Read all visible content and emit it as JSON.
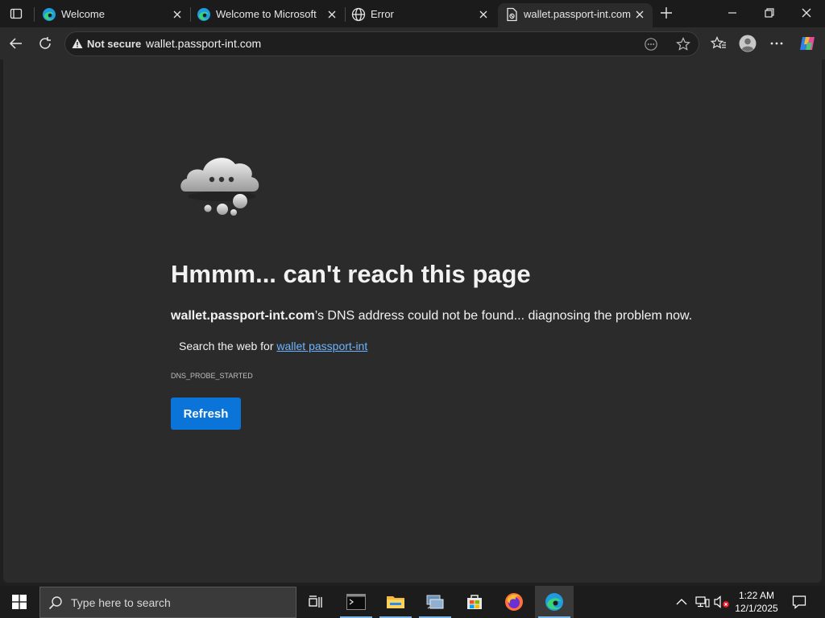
{
  "tabs": [
    {
      "label": "Welcome",
      "favicon": "edge-icon",
      "active": false
    },
    {
      "label": "Welcome to Microsoft E",
      "favicon": "edge-icon",
      "active": false
    },
    {
      "label": "Error",
      "favicon": "globe-icon",
      "active": false
    },
    {
      "label": "wallet.passport-int.com",
      "favicon": "page-error-icon",
      "active": true
    }
  ],
  "address": {
    "security_label": "Not secure",
    "url": "wallet.passport-int.com"
  },
  "error": {
    "headline": "Hmmm... can't reach this page",
    "host": "wallet.passport-int.com",
    "message": "’s DNS address could not be found... diagnosing the problem now.",
    "search_prefix": "Search the web for ",
    "search_link": "wallet passport-int",
    "code": "DNS_PROBE_STARTED",
    "refresh_label": "Refresh"
  },
  "taskbar": {
    "search_placeholder": "Type here to search",
    "time": "1:22 AM",
    "date": "12/1/2025"
  },
  "colors": {
    "accent": "#0a74d8",
    "link": "#6cb4ff",
    "page_bg": "#2b2b2b"
  }
}
